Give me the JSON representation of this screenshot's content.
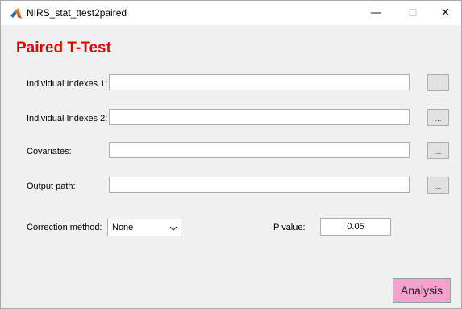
{
  "window": {
    "title": "NIRS_stat_ttest2paired",
    "controls": {
      "minimize": "—",
      "maximize": "☐",
      "close": "✕"
    }
  },
  "heading": "Paired T-Test",
  "fields": [
    {
      "label": "Individual Indexes 1:",
      "value": "",
      "browse_label": "..."
    },
    {
      "label": "Individual Indexes 2:",
      "value": "",
      "browse_label": "..."
    },
    {
      "label": "Covariates:",
      "value": "",
      "browse_label": "..."
    },
    {
      "label": "Output path:",
      "value": "",
      "browse_label": "..."
    }
  ],
  "correction": {
    "label": "Correction method:",
    "selected": "None"
  },
  "pvalue": {
    "label": "P value:",
    "value": "0.05"
  },
  "analysis_button": "Analysis",
  "colors": {
    "heading": "#e30000",
    "analysis_button": "#f7a1cf",
    "window_bg": "#f0f0f0"
  }
}
